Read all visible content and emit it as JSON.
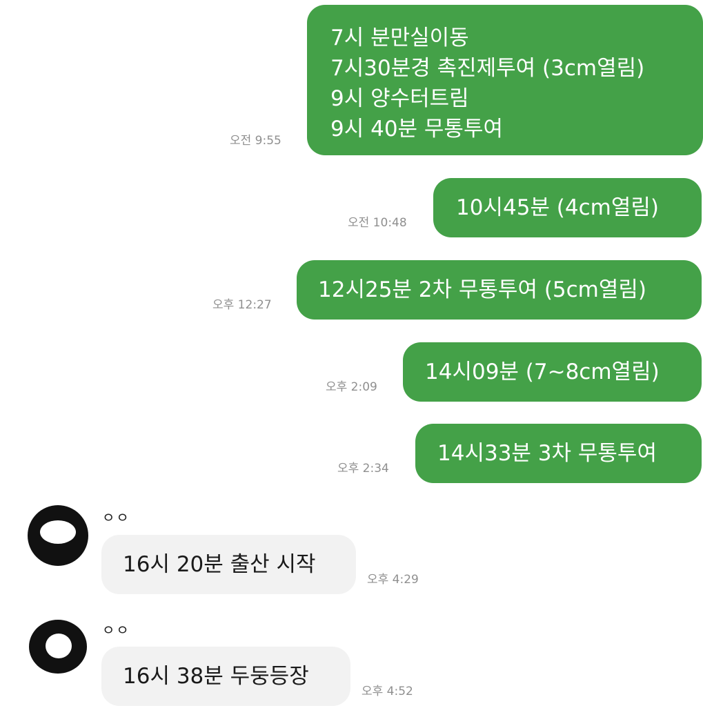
{
  "messages": [
    {
      "direction": "out",
      "text": "7시 분만실이동\n7시30분경 촉진제투여 (3cm열림)\n9시 양수터트림\n9시 40분 무통투여",
      "time": "오전 9:55"
    },
    {
      "direction": "out",
      "text": "10시45분 (4cm열림)",
      "time": "오전 10:48"
    },
    {
      "direction": "out",
      "text": "12시25분 2차 무통투여 (5cm열림)",
      "time": "오후 12:27"
    },
    {
      "direction": "out",
      "text": "14시09분 (7~8cm열림)",
      "time": "오후 2:09"
    },
    {
      "direction": "out",
      "text": "14시33분 3차 무통투여",
      "time": "오후 2:34"
    },
    {
      "direction": "in",
      "sender": "ㅇㅇ",
      "text": "16시 20분 출산 시작",
      "time": "오후 4:29"
    },
    {
      "direction": "in",
      "sender": "ㅇㅇ",
      "text": "16시 38분 두둥등장",
      "time": "오후 4:52"
    }
  ],
  "colors": {
    "outgoing_bubble": "#44a148",
    "incoming_bubble": "#f2f2f2",
    "timestamp": "#8f8f8f"
  }
}
